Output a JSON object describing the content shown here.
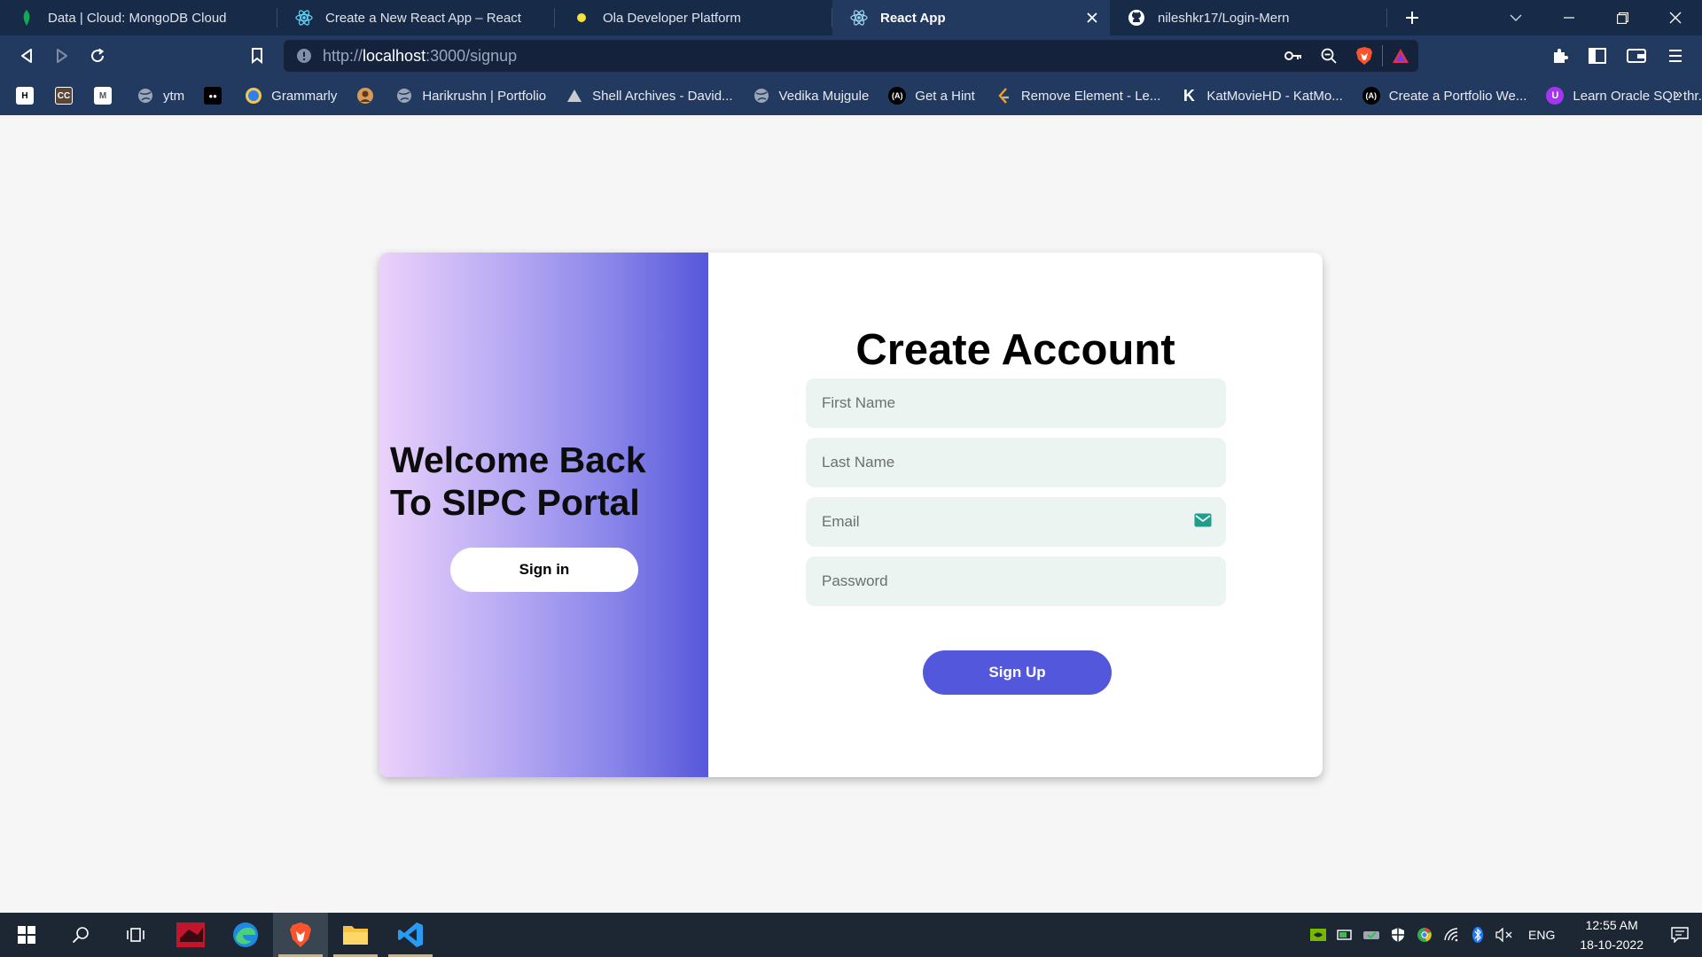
{
  "browser": {
    "tabs": [
      {
        "title": "Data | Cloud: MongoDB Cloud",
        "icon": "mongodb-leaf-icon",
        "active": false
      },
      {
        "title": "Create a New React App – React",
        "icon": "react-icon",
        "active": false
      },
      {
        "title": "Ola Developer Platform",
        "icon": "ola-dot-icon",
        "active": false
      },
      {
        "title": "React App",
        "icon": "react-icon",
        "active": true
      },
      {
        "title": "nileshkr17/Login-Mern",
        "icon": "github-icon",
        "active": false
      }
    ],
    "url": {
      "scheme": "http://",
      "host": "localhost",
      "rest": ":3000/signup"
    },
    "bookmarks": [
      {
        "label": "",
        "icon": "hackerearth-icon",
        "abbr": "H"
      },
      {
        "label": "",
        "icon": "codechef-icon",
        "abbr": "CC"
      },
      {
        "label": "",
        "icon": "gmail-icon",
        "abbr": "M"
      },
      {
        "label": "ytm",
        "icon": "globe-icon"
      },
      {
        "label": "",
        "icon": "medium-icon",
        "abbr": "●●"
      },
      {
        "label": "Grammarly",
        "icon": "grammarly-icon"
      },
      {
        "label": "",
        "icon": "avatar-icon"
      },
      {
        "label": "Harikrushn | Portfolio",
        "icon": "globe-icon"
      },
      {
        "label": "Shell Archives - David...",
        "icon": "shell-icon"
      },
      {
        "label": "Vedika Mujgule",
        "icon": "globe-icon"
      },
      {
        "label": "Get a Hint",
        "icon": "angular-icon",
        "abbr": "(A)"
      },
      {
        "label": "Remove Element - Le...",
        "icon": "leetcode-icon"
      },
      {
        "label": "KatMovieHD - KatMo...",
        "icon": "katmovie-icon",
        "abbr": "K"
      },
      {
        "label": "Create a Portfolio We...",
        "icon": "angular-icon",
        "abbr": "(A)"
      },
      {
        "label": "Learn Oracle SQL thr...",
        "icon": "udemy-icon",
        "abbr": "U"
      }
    ],
    "bookmarks_more": "»"
  },
  "page": {
    "welcome_line1": "Welcome Back",
    "welcome_line2": "To SIPC Portal",
    "signin_label": "Sign in",
    "title": "Create Account",
    "first_name_placeholder": "First Name",
    "last_name_placeholder": "Last Name",
    "email_placeholder": "Email",
    "password_placeholder": "Password",
    "signup_label": "Sign Up",
    "colors": {
      "gradient_start": "#ebd2fb",
      "gradient_end": "#5657da",
      "field_bg": "#ecf4f2",
      "signup_bg": "#5257db"
    }
  },
  "taskbar": {
    "lang": "ENG",
    "time": "12:55 AM",
    "date": "18-10-2022"
  }
}
